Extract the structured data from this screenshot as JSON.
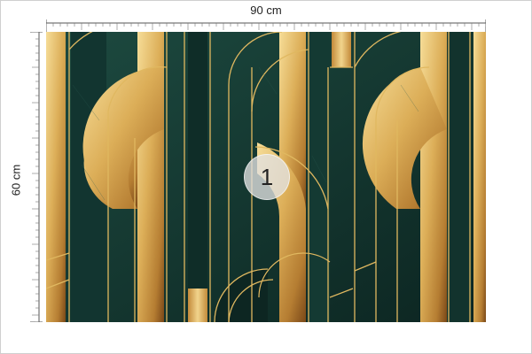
{
  "dimensions": {
    "width_label": "90 cm",
    "height_label": "60 cm"
  },
  "panel": {
    "number": "1"
  },
  "colors": {
    "background_dark": "#0f2b26",
    "panel_mid": "#163a33",
    "gold_light": "#f2d58a",
    "gold_mid": "#d6a64e",
    "gold_dark": "#8a5a1e",
    "line_gold": "#e0b860"
  }
}
